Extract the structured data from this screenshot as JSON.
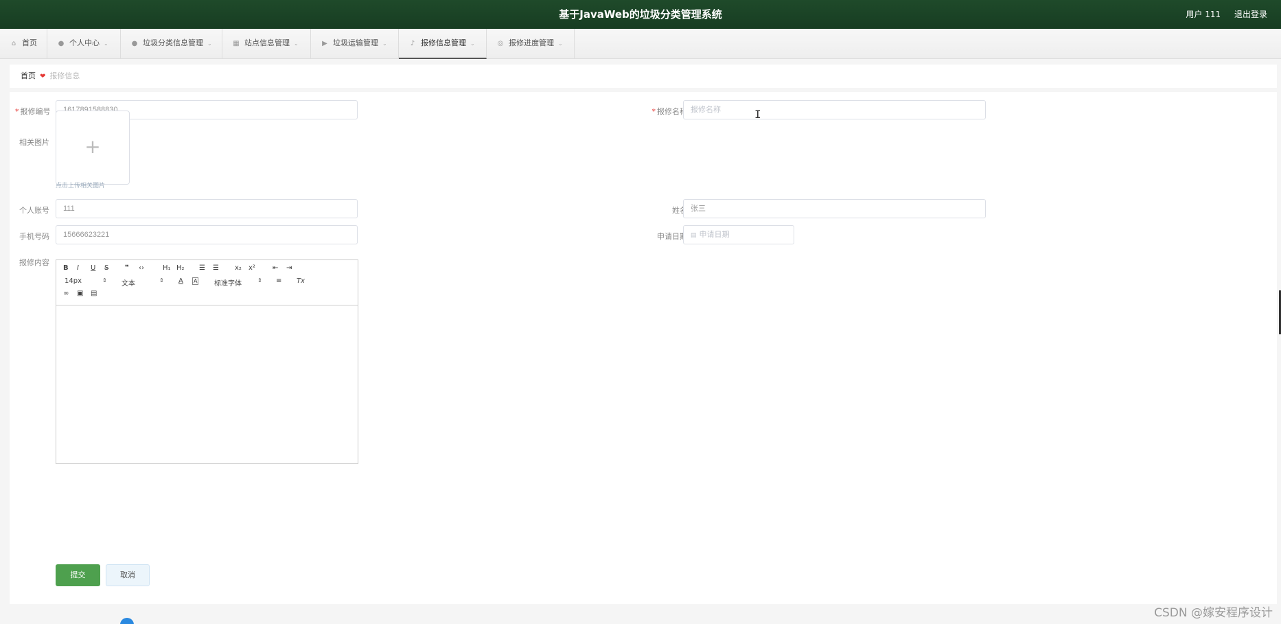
{
  "header": {
    "title": "基于JavaWeb的垃圾分类管理系统",
    "user": "用户 111",
    "logout": "退出登录"
  },
  "nav": {
    "items": [
      {
        "label": "首页",
        "icon": "home-icon"
      },
      {
        "label": "个人中心",
        "icon": "user-icon"
      },
      {
        "label": "垃圾分类信息管理",
        "icon": "user-icon"
      },
      {
        "label": "站点信息管理",
        "icon": "grid-icon"
      },
      {
        "label": "垃圾运输管理",
        "icon": "truck-icon"
      },
      {
        "label": "报修信息管理",
        "icon": "bell-icon"
      },
      {
        "label": "报修进度管理",
        "icon": "compass-icon"
      }
    ]
  },
  "breadcrumb": {
    "home": "首页",
    "current": "报修信息"
  },
  "form": {
    "repair_no": {
      "label": "报修编号",
      "value": "1617891588830"
    },
    "repair_name": {
      "label": "报修名称",
      "placeholder": "报修名称"
    },
    "image": {
      "label": "相关图片",
      "hint": "点击上传相关图片"
    },
    "account": {
      "label": "个人账号",
      "value": "111"
    },
    "name": {
      "label": "姓名",
      "value": "张三"
    },
    "phone": {
      "label": "手机号码",
      "value": "15666623221"
    },
    "apply_date": {
      "label": "申请日期",
      "placeholder": "申请日期"
    },
    "content": {
      "label": "报修内容"
    }
  },
  "editor": {
    "font_size": "14px",
    "text_type": "文本",
    "font_family": "标准字体"
  },
  "buttons": {
    "submit": "提交",
    "cancel": "取消"
  },
  "watermark": "CSDN @嫁安程序设计"
}
